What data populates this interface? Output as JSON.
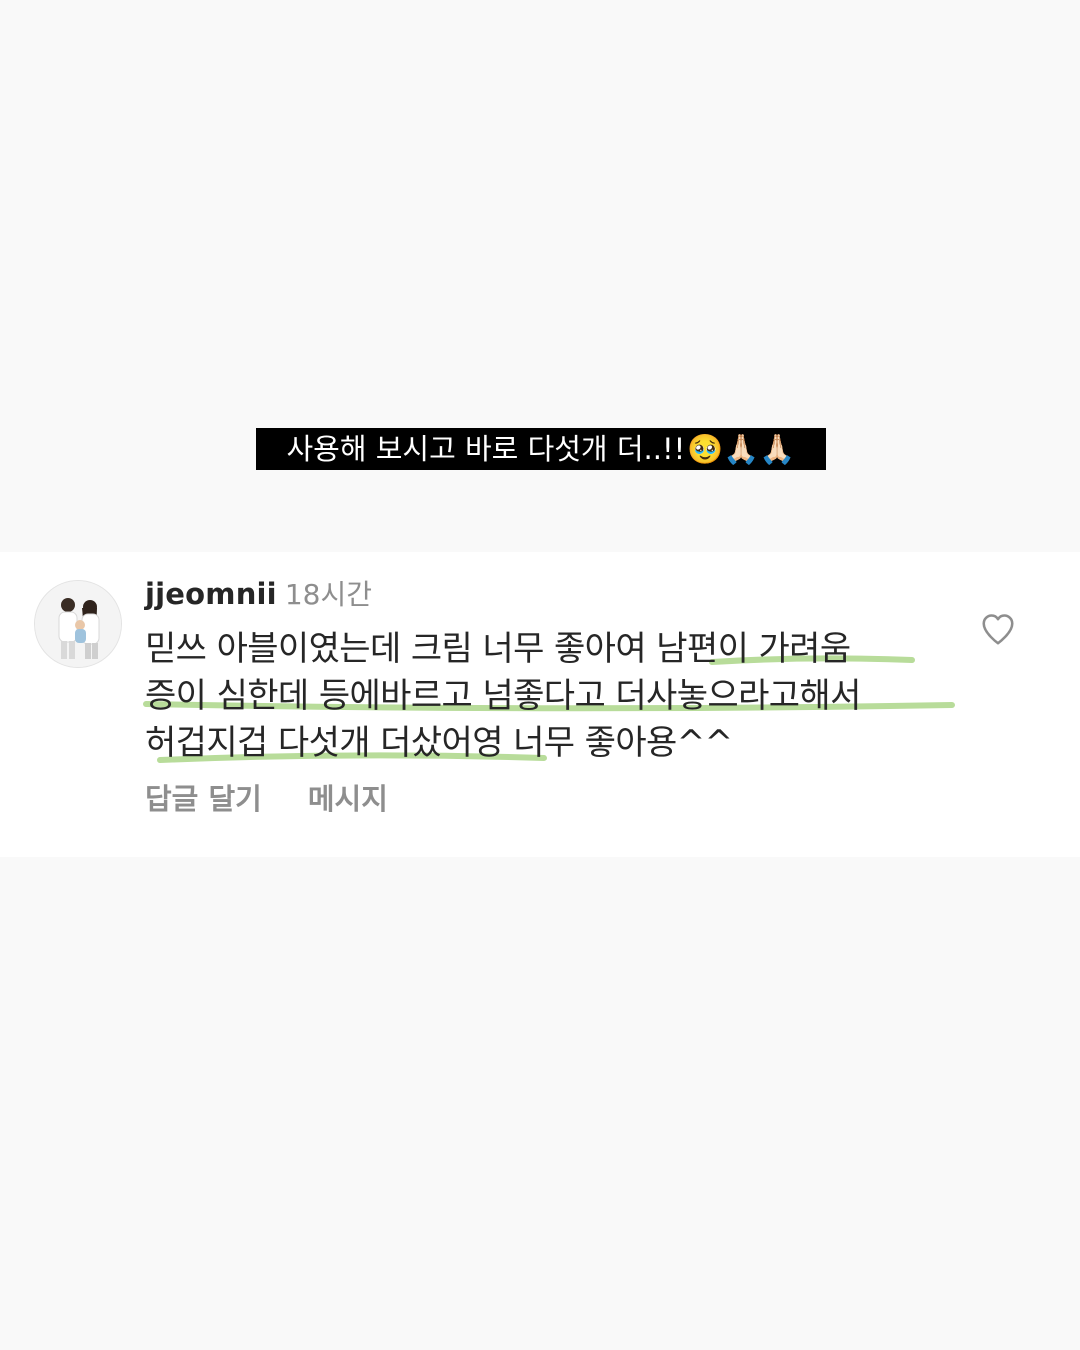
{
  "caption": {
    "text": "사용해 보시고 바로 다섯개 더..!!",
    "emojis": "🥹🙏🏻🙏🏻"
  },
  "comment": {
    "username": "jjeomnii",
    "time": "18시간",
    "lines": [
      "믿쓰 아블이였는데 크림 너무 좋아여 남편이 가려움",
      "증이 심한데 등에바르고 넘좋다고 더사놓으라고해서",
      "허겁지겁 다섯개 더샀어영 너무 좋아용^^"
    ],
    "highlight_color": "#b8dc9a",
    "actions": {
      "reply": "답글 달기",
      "message": "메시지"
    },
    "icons": {
      "like": "heart-outline-icon",
      "avatar": "family-photo-avatar"
    }
  }
}
